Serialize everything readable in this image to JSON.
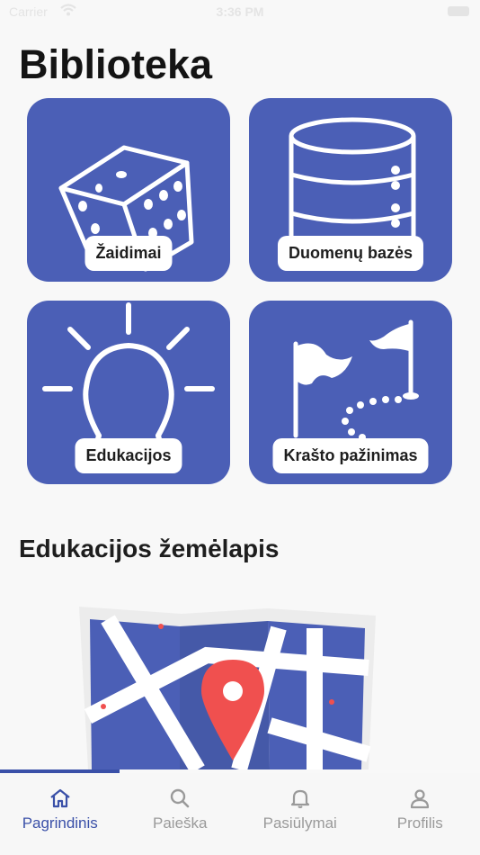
{
  "status_bar": {
    "carrier": "Carrier",
    "time": "3:36 PM"
  },
  "page_title": "Biblioteka",
  "tiles": [
    {
      "label": "Žaidimai",
      "icon": "dice-icon"
    },
    {
      "label": "Duomenų bazės",
      "icon": "database-icon"
    },
    {
      "label": "Edukacijos",
      "icon": "lightbulb-icon"
    },
    {
      "label": "Krašto pažinimas",
      "icon": "flags-route-icon"
    }
  ],
  "map_section": {
    "title": "Edukacijos žemėlapis",
    "icon": "map-pin-illustration"
  },
  "tab_bar": {
    "active_index": 0,
    "tabs": [
      {
        "label": "Pagrindinis",
        "icon": "home-icon"
      },
      {
        "label": "Paieška",
        "icon": "search-icon"
      },
      {
        "label": "Pasiūlymai",
        "icon": "bell-icon"
      },
      {
        "label": "Profilis",
        "icon": "person-icon"
      }
    ]
  },
  "colors": {
    "tile": "#4b5fb6",
    "accent": "#3a50a8",
    "pin": "#f0504f"
  }
}
